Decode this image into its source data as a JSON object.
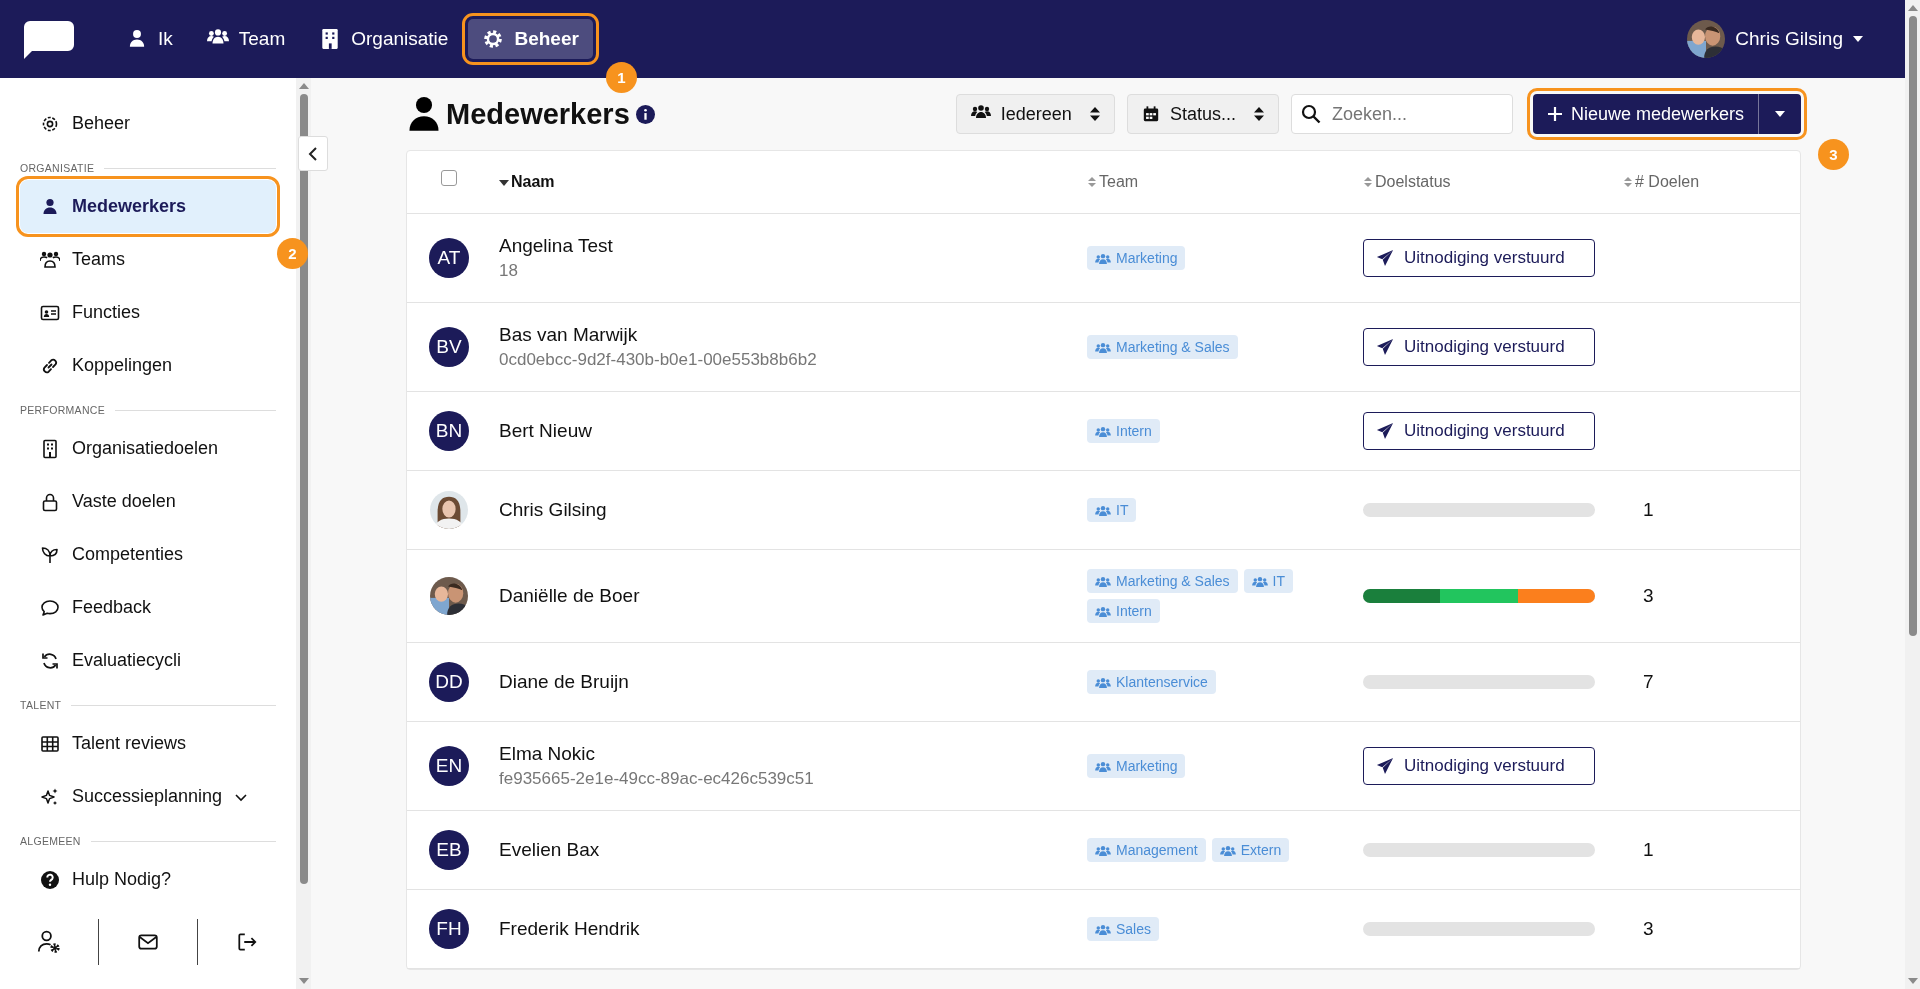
{
  "nav": {
    "items": [
      {
        "label": "Ik",
        "selected": false
      },
      {
        "label": "Team",
        "selected": false
      },
      {
        "label": "Organisatie",
        "selected": false
      },
      {
        "label": "Beheer",
        "selected": true,
        "callout": "1"
      }
    ],
    "user": {
      "name": "Chris Gilsing"
    }
  },
  "sidebar": {
    "top": {
      "label": "Beheer"
    },
    "sections": [
      {
        "title": "ORGANISATIE",
        "items": [
          {
            "label": "Medewerkers",
            "selected": true,
            "callout": "2"
          },
          {
            "label": "Teams",
            "selected": false
          },
          {
            "label": "Functies",
            "selected": false
          },
          {
            "label": "Koppelingen",
            "selected": false
          }
        ]
      },
      {
        "title": "PERFORMANCE",
        "items": [
          {
            "label": "Organisatiedoelen",
            "selected": false
          },
          {
            "label": "Vaste doelen",
            "selected": false
          },
          {
            "label": "Competenties",
            "selected": false
          },
          {
            "label": "Feedback",
            "selected": false
          },
          {
            "label": "Evaluatiecycli",
            "selected": false
          }
        ]
      },
      {
        "title": "TALENT",
        "items": [
          {
            "label": "Talent reviews",
            "selected": false
          },
          {
            "label": "Successieplanning",
            "selected": false,
            "kind": "group"
          }
        ]
      },
      {
        "title": "ALGEMEEN",
        "items": [
          {
            "label": "Hulp Nodig?",
            "selected": false
          }
        ]
      }
    ]
  },
  "page": {
    "title": "Medewerkers",
    "filters": [
      {
        "label": "Iedereen"
      },
      {
        "label": "Status..."
      }
    ],
    "search": {
      "placeholder": "Zoeken..."
    },
    "new_button": {
      "label": "Nieuwe medewerkers",
      "callout": "3"
    }
  },
  "table": {
    "select_all": {
      "checked": false
    },
    "columns": [
      {
        "label": "Naam",
        "sorted": true
      },
      {
        "label": "Team",
        "sorted": false
      },
      {
        "label": "Doelstatus",
        "sorted": false
      },
      {
        "label": "# Doelen",
        "sorted": false
      }
    ],
    "rows": [
      {
        "avatar": {
          "kind": "initials",
          "initials": "AT"
        },
        "name": "Angelina Test",
        "sub": "18",
        "teams": [
          "Marketing"
        ],
        "status": {
          "kind": "invite",
          "label": "Uitnodiging verstuurd"
        }
      },
      {
        "avatar": {
          "kind": "initials",
          "initials": "BV"
        },
        "name": "Bas van Marwijk",
        "sub": "0cd0ebcc-9d2f-430b-b0e1-00e553b8b6b2",
        "teams": [
          "Marketing & Sales"
        ],
        "status": {
          "kind": "invite",
          "label": "Uitnodiging verstuurd"
        }
      },
      {
        "avatar": {
          "kind": "initials",
          "initials": "BN"
        },
        "name": "Bert Nieuw",
        "teams": [
          "Intern"
        ],
        "status": {
          "kind": "invite",
          "label": "Uitnodiging verstuurd"
        }
      },
      {
        "avatar": {
          "kind": "picture"
        },
        "name": "Chris Gilsing",
        "teams": [
          "IT"
        ],
        "status": {
          "kind": "bar"
        },
        "goals": "1"
      },
      {
        "avatar": {
          "kind": "picture"
        },
        "name": "Daniëlle de Boer",
        "teams": [
          "Marketing & Sales",
          "IT",
          "Intern"
        ],
        "status": {
          "kind": "bar",
          "segments": [
            {
              "color": "#1a7f3c"
            },
            {
              "color": "#22c55e"
            },
            {
              "color": "#fb7f1d"
            }
          ]
        },
        "goals": "3"
      },
      {
        "avatar": {
          "kind": "initials",
          "initials": "DD"
        },
        "name": "Diane de Bruijn",
        "teams": [
          "Klantenservice"
        ],
        "status": {
          "kind": "bar"
        },
        "goals": "7"
      },
      {
        "avatar": {
          "kind": "initials",
          "initials": "EN"
        },
        "name": "Elma Nokic",
        "sub": "fe935665-2e1e-49cc-89ac-ec426c539c51",
        "teams": [
          "Marketing"
        ],
        "status": {
          "kind": "invite",
          "label": "Uitnodiging verstuurd"
        }
      },
      {
        "avatar": {
          "kind": "initials",
          "initials": "EB"
        },
        "name": "Evelien Bax",
        "teams": [
          "Management",
          "Extern"
        ],
        "status": {
          "kind": "bar"
        },
        "goals": "1"
      },
      {
        "avatar": {
          "kind": "initials",
          "initials": "FH"
        },
        "name": "Frederik Hendrik",
        "teams": [
          "Sales"
        ],
        "status": {
          "kind": "bar"
        },
        "goals": "3"
      }
    ]
  }
}
